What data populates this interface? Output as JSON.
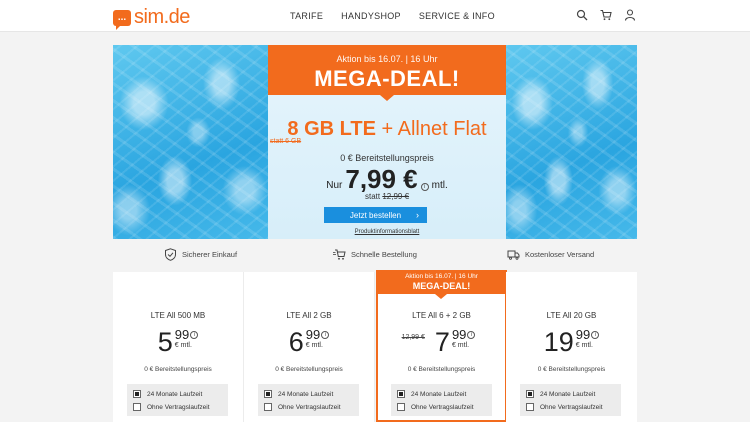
{
  "header": {
    "logo_glyph": "...",
    "logo_text": "sim.de",
    "nav": [
      "TARIFE",
      "HANDYSHOP",
      "SERVICE & INFO"
    ],
    "icons": [
      "search-icon",
      "cart-icon",
      "user-icon"
    ]
  },
  "hero": {
    "deal_top": "Aktion bis 16.07. | 16 Uhr",
    "deal_big": "MEGA-DEAL!",
    "offer_bold": "8 GB LTE",
    "offer_rest": " + Allnet Flat",
    "statt_data": "statt 6 GB",
    "bereitstellung": "0 € Bereitstellungspreis",
    "nur": "Nur",
    "price": "7,99 €",
    "mtl": "mtl.",
    "statt_label": "statt",
    "old_price": "12,99 €",
    "cta": "Jetzt bestellen",
    "cta_chevron": "›",
    "produkt_link": "Produktinformationsblatt"
  },
  "trust": {
    "items": [
      "Sicherer Einkauf",
      "Schnelle Bestellung",
      "Kostenloser Versand"
    ]
  },
  "cards": [
    {
      "name": "LTE All 500 MB",
      "whole": "5",
      "cents": "99",
      "unit": "€ mtl.",
      "old": "",
      "bereit": "0 € Bereitstellungspreis",
      "opt1": "24 Monate Laufzeit",
      "opt2": "Ohne Vertragslaufzeit",
      "featured": false
    },
    {
      "name": "LTE All 2 GB",
      "whole": "6",
      "cents": "99",
      "unit": "€ mtl.",
      "old": "",
      "bereit": "0 € Bereitstellungspreis",
      "opt1": "24 Monate Laufzeit",
      "opt2": "Ohne Vertragslaufzeit",
      "featured": false
    },
    {
      "name": "LTE All 6 + 2 GB",
      "whole": "7",
      "cents": "99",
      "unit": "€ mtl.",
      "old": "12,99 €",
      "bereit": "0 € Bereitstellungspreis",
      "opt1": "24 Monate Laufzeit",
      "opt2": "Ohne Vertragslaufzeit",
      "featured": true,
      "flag_top": "Aktion bis 16.07. | 16 Uhr",
      "flag_big": "MEGA-DEAL!"
    },
    {
      "name": "LTE All 20 GB",
      "whole": "19",
      "cents": "99",
      "unit": "€ mtl.",
      "old": "",
      "bereit": "0 € Bereitstellungspreis",
      "opt1": "24 Monate Laufzeit",
      "opt2": "Ohne Vertragslaufzeit",
      "featured": false
    }
  ],
  "colors": {
    "brand": "#f26b1d",
    "cta": "#1a8fde"
  }
}
